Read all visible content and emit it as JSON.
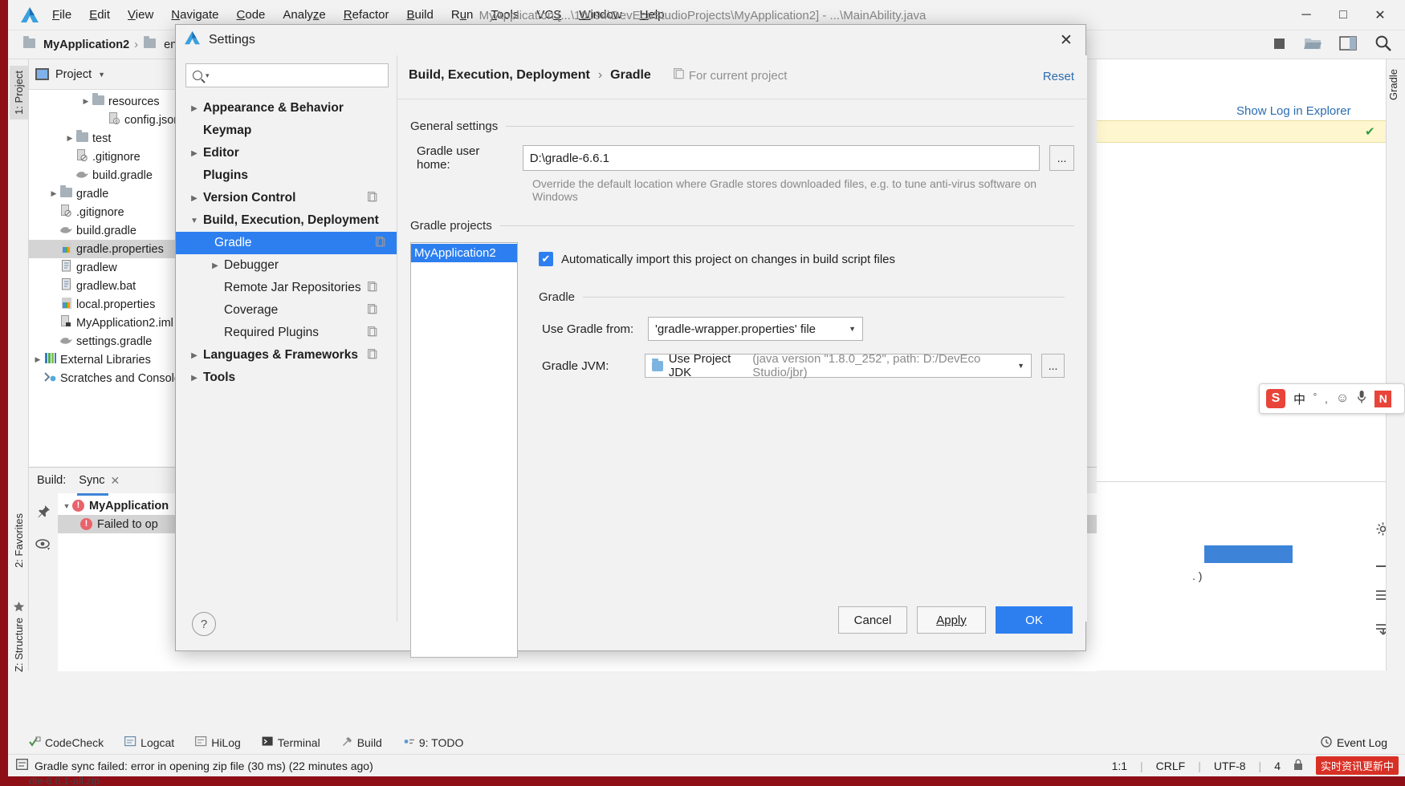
{
  "window": {
    "title": "MyApplication [...\\10094\\DevEcoStudioProjects\\MyApplication2] - ...\\MainAbility.java",
    "minimize": "─",
    "maximize": "□",
    "close": "✕"
  },
  "menu": [
    {
      "label": "File"
    },
    {
      "label": "Edit"
    },
    {
      "label": "View"
    },
    {
      "label": "Navigate"
    },
    {
      "label": "Code"
    },
    {
      "label": "Analyze"
    },
    {
      "label": "Refactor"
    },
    {
      "label": "Build"
    },
    {
      "label": "Run"
    },
    {
      "label": "Tools"
    },
    {
      "label": "VCS"
    },
    {
      "label": "Window"
    },
    {
      "label": "Help"
    }
  ],
  "breadcrumb": {
    "project": "MyApplication2",
    "sep": "›",
    "entry": "entry"
  },
  "left_strip": {
    "project_tab": "1: Project",
    "favorites_tab": "2: Favorites",
    "structure_tab": "Z: Structure"
  },
  "right_strip": {
    "gradle_tab": "Gradle"
  },
  "project_panel": {
    "header": "Project",
    "items": [
      {
        "label": "resources",
        "indent": 4,
        "arrow": "▶",
        "icon": "folder",
        "selected": false
      },
      {
        "label": "config.json",
        "indent": 5,
        "arrow": "",
        "icon": "json",
        "selected": false
      },
      {
        "label": "test",
        "indent": 3,
        "arrow": "▶",
        "icon": "folder",
        "selected": false
      },
      {
        "label": ".gitignore",
        "indent": 3,
        "arrow": "",
        "icon": "gitignore",
        "selected": false
      },
      {
        "label": "build.gradle",
        "indent": 3,
        "arrow": "",
        "icon": "gradle",
        "selected": false
      },
      {
        "label": "gradle",
        "indent": 2,
        "arrow": "▶",
        "icon": "folder",
        "selected": false
      },
      {
        "label": ".gitignore",
        "indent": 2,
        "arrow": "",
        "icon": "gitignore",
        "selected": false
      },
      {
        "label": "build.gradle",
        "indent": 2,
        "arrow": "",
        "icon": "gradle",
        "selected": false
      },
      {
        "label": "gradle.properties",
        "indent": 2,
        "arrow": "",
        "icon": "properties",
        "selected": true
      },
      {
        "label": "gradlew",
        "indent": 2,
        "arrow": "",
        "icon": "doc",
        "selected": false
      },
      {
        "label": "gradlew.bat",
        "indent": 2,
        "arrow": "",
        "icon": "doc",
        "selected": false
      },
      {
        "label": "local.properties",
        "indent": 2,
        "arrow": "",
        "icon": "properties",
        "selected": false
      },
      {
        "label": "MyApplication2.iml",
        "indent": 2,
        "arrow": "",
        "icon": "iml",
        "selected": false
      },
      {
        "label": "settings.gradle",
        "indent": 2,
        "arrow": "",
        "icon": "gradle",
        "selected": false
      },
      {
        "label": "External Libraries",
        "indent": 1,
        "arrow": "▶",
        "icon": "library",
        "selected": false
      },
      {
        "label": "Scratches and Consoles",
        "indent": 1,
        "arrow": "",
        "icon": "scratch",
        "selected": false
      }
    ]
  },
  "build_window": {
    "label": "Build:",
    "tab": "Sync",
    "tab_close": "✕",
    "root_node": "MyApplication",
    "child_node": "Failed to op",
    "error_glyph": "!"
  },
  "editor_right": {
    "show_log": "Show Log in Explorer",
    "check": "✔",
    "console_text": ". )"
  },
  "ime": {
    "s_glyph": "S",
    "mode": "中",
    "punct": "゜,",
    "emoji": "☺",
    "mic": "🎤",
    "n_glyph": "N"
  },
  "bottom_tabs": [
    {
      "label": "CodeCheck",
      "icon": "codecheck-icon"
    },
    {
      "label": "Logcat",
      "icon": "logcat-icon"
    },
    {
      "label": "HiLog",
      "icon": "hilog-icon"
    },
    {
      "label": "Terminal",
      "icon": "terminal-icon"
    },
    {
      "label": "Build",
      "icon": "build-icon"
    },
    {
      "label": "9: TODO",
      "icon": "todo-icon"
    }
  ],
  "event_log": {
    "label": "Event Log",
    "icon": "event-log-icon"
  },
  "status_bar": {
    "message": "Gradle sync failed: error in opening zip file (30 ms) (22 minutes ago)",
    "caret": "1:1",
    "line_sep": "CRLF",
    "encoding": "UTF-8",
    "indent": "4",
    "ime_text": "实时资讯更新中"
  },
  "zip_hint": "dle-6.6.1-all.zip",
  "dialog": {
    "title": "Settings",
    "close": "✕",
    "search": {
      "placeholder": "",
      "value": "",
      "icon": "search-icon",
      "caret": "▾"
    },
    "tree": [
      {
        "label": "Appearance & Behavior",
        "arrow": "▶",
        "level": 1,
        "bold": true,
        "selected": false,
        "config": false
      },
      {
        "label": "Keymap",
        "arrow": "",
        "level": 1,
        "bold": true,
        "selected": false,
        "config": false
      },
      {
        "label": "Editor",
        "arrow": "▶",
        "level": 1,
        "bold": true,
        "selected": false,
        "config": false
      },
      {
        "label": "Plugins",
        "arrow": "",
        "level": 1,
        "bold": true,
        "selected": false,
        "config": false
      },
      {
        "label": "Version Control",
        "arrow": "▶",
        "level": 1,
        "bold": true,
        "selected": false,
        "config": true
      },
      {
        "label": "Build, Execution, Deployment",
        "arrow": "▼",
        "level": 1,
        "bold": true,
        "selected": false,
        "config": false
      },
      {
        "label": "Gradle",
        "arrow": "",
        "level": 2,
        "bold": false,
        "selected": true,
        "config": true
      },
      {
        "label": "Debugger",
        "arrow": "▶",
        "level": 2,
        "bold": false,
        "selected": false,
        "config": false
      },
      {
        "label": "Remote Jar Repositories",
        "arrow": "",
        "level": 2,
        "bold": false,
        "selected": false,
        "config": true
      },
      {
        "label": "Coverage",
        "arrow": "",
        "level": 2,
        "bold": false,
        "selected": false,
        "config": true
      },
      {
        "label": "Required Plugins",
        "arrow": "",
        "level": 2,
        "bold": false,
        "selected": false,
        "config": true
      },
      {
        "label": "Languages & Frameworks",
        "arrow": "▶",
        "level": 1,
        "bold": true,
        "selected": false,
        "config": true
      },
      {
        "label": "Tools",
        "arrow": "▶",
        "level": 1,
        "bold": true,
        "selected": false,
        "config": false
      }
    ],
    "breadcrumb": {
      "parent": "Build, Execution, Deployment",
      "sep": "›",
      "current": "Gradle",
      "scope": "For current project",
      "reset": "Reset"
    },
    "general_settings": {
      "group_title": "General settings",
      "user_home_label": "Gradle user home:",
      "user_home_value": "D:\\gradle-6.6.1",
      "browse_button": "...",
      "hint": "Override the default location where Gradle stores downloaded files, e.g. to tune anti-virus software on Windows"
    },
    "gradle_projects": {
      "group_title": "Gradle projects",
      "projects": [
        "MyApplication2"
      ],
      "auto_import_label": "Automatically import this project on changes in build script files",
      "auto_import_checked": true,
      "check_glyph": "✔",
      "gradle_group_title": "Gradle",
      "use_gradle_from_label": "Use Gradle from:",
      "use_gradle_from_value": "'gradle-wrapper.properties' file",
      "gradle_jvm_label": "Gradle JVM:",
      "gradle_jvm_value": "Use Project JDK",
      "gradle_jvm_detail": "(java version \"1.8.0_252\", path: D:/DevEco Studio/jbr)",
      "jvm_browse_button": "...",
      "caret": "▼"
    },
    "footer": {
      "help": "?",
      "cancel": "Cancel",
      "apply": "Apply",
      "ok": "OK"
    }
  }
}
